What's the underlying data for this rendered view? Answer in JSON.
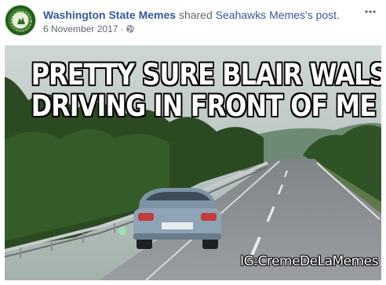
{
  "post": {
    "page_name": "Washington State Memes",
    "shared_text": " shared ",
    "shared_post": "Seahawks Memes's post.",
    "date": "6 November 2017",
    "dot": "·",
    "icons": {
      "avatar": "page-avatar",
      "globe": "globe-icon",
      "more": "more-options-icon"
    }
  },
  "image": {
    "caption_line1": "PRETTY SURE BLAIR WALSH IS",
    "caption_line2": "DRIVING IN FRONT OF ME",
    "watermark": "IG:CremeDeLaMemes",
    "colors": {
      "sky": "#a9b6b0",
      "trees": "#2d4a22",
      "road": "#8b8f93",
      "car": "#8fa2b2",
      "text": "#ffffff"
    }
  },
  "colors": {
    "link": "#365899",
    "meta": "#616770"
  }
}
